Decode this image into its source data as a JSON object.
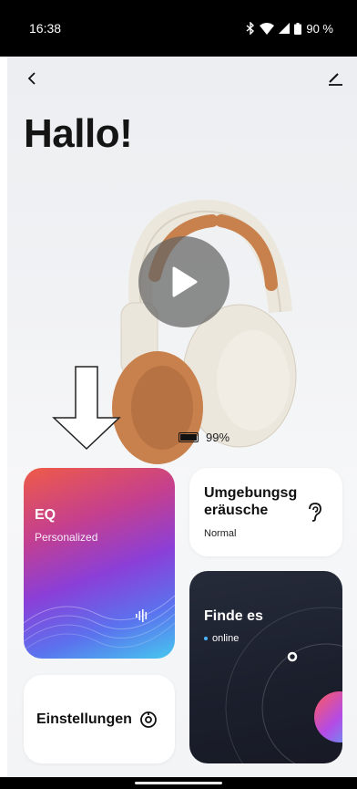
{
  "status_bar": {
    "time": "16:38",
    "battery_percent": "90 %"
  },
  "header": {
    "title": "Hallo!"
  },
  "device": {
    "battery": "99%",
    "battery_level": 0.99
  },
  "cards": {
    "eq": {
      "title": "EQ",
      "subtitle": "Personalized"
    },
    "ambient": {
      "title": "Umgebungsgeräusche",
      "subtitle": "Normal"
    },
    "find": {
      "title": "Finde es",
      "status": "online"
    },
    "settings": {
      "title": "Einstellungen"
    }
  },
  "colors": {
    "eq_gradient": [
      "#ef5b47",
      "#8a3fd8",
      "#45c8ee"
    ],
    "find_card": "#1b1f2c",
    "online_dot": "#4bb6ff",
    "headphone_accent": "#c8814c"
  },
  "icons": [
    "back-icon",
    "edit-icon",
    "play-icon",
    "battery-icon",
    "ear-icon",
    "sound-wave-icon",
    "settings-icon",
    "bluetooth-icon",
    "wifi-icon",
    "signal-icon"
  ]
}
